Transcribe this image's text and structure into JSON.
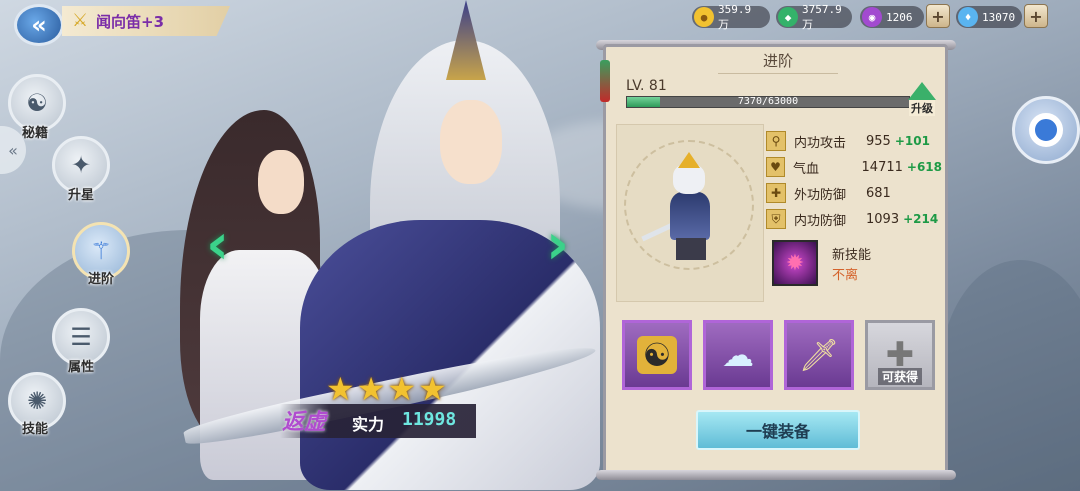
{
  "header": {
    "back_icon": "back-arrow-icon",
    "character_title": "闻向笛+3"
  },
  "currencies": [
    {
      "name": "gold",
      "icon": "gold-coin-icon",
      "value": "359.9万",
      "color": "#f2c230"
    },
    {
      "name": "jade",
      "icon": "jade-icon",
      "value": "3757.9万",
      "color": "#34b26a"
    },
    {
      "name": "spirit",
      "icon": "purple-orb-icon",
      "value": "1206",
      "color": "#a24ad0"
    },
    {
      "name": "diamond",
      "icon": "diamond-icon",
      "value": "13070",
      "color": "#5ab4f0"
    }
  ],
  "nav": [
    {
      "key": "secrets",
      "label": "秘籍",
      "icon": "yin-yang-icon"
    },
    {
      "key": "star-up",
      "label": "升星",
      "icon": "stars-icon"
    },
    {
      "key": "advance",
      "label": "进阶",
      "icon": "advance-sword-icon",
      "active": true
    },
    {
      "key": "attributes",
      "label": "属性",
      "icon": "attributes-icon"
    },
    {
      "key": "skills",
      "label": "技能",
      "icon": "skill-gear-icon"
    }
  ],
  "hero": {
    "stars": 4,
    "realm": "返虚",
    "power_label": "实力",
    "power_value": "11998"
  },
  "panel": {
    "title": "进阶",
    "level": "LV. 81",
    "exp_text": "7370/63000",
    "exp_current": 7370,
    "exp_max": 63000,
    "upgrade_label": "升级",
    "stats": [
      {
        "icon": "attack-icon",
        "name": "内功攻击",
        "value": "955",
        "bonus": "+101"
      },
      {
        "icon": "heart-icon",
        "name": "气血",
        "value": "14711",
        "bonus": "+618"
      },
      {
        "icon": "armor-icon",
        "name": "外功防御",
        "value": "681",
        "bonus": ""
      },
      {
        "icon": "shield-icon",
        "name": "内功防御",
        "value": "1093",
        "bonus": "+214"
      }
    ],
    "new_skill_title": "新技能",
    "new_skill_name": "不离",
    "equipment_slots": [
      {
        "icon": "yin-yang-token-icon",
        "glyph": "☯"
      },
      {
        "icon": "cloud-stone-icon",
        "glyph": "☁"
      },
      {
        "icon": "sword-icon",
        "glyph": "🗡"
      },
      {
        "icon": "plus-icon",
        "glyph": "✚",
        "label": "可获得",
        "empty": true
      }
    ],
    "equip_all_label": "一键装备"
  }
}
